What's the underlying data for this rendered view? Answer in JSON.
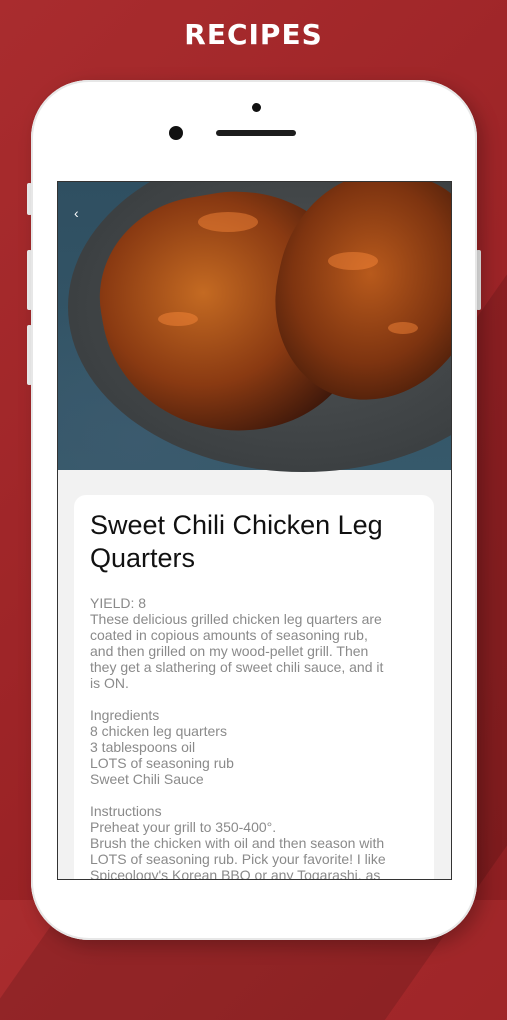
{
  "banner": {
    "title": "RECIPES"
  },
  "nav": {
    "back_icon": "chevron-left-icon",
    "back_glyph": "‹"
  },
  "recipe": {
    "title": "Sweet Chili Chicken Leg Quarters",
    "yield": "YIELD: 8",
    "description": [
      "These delicious grilled chicken leg quarters are",
      "coated in copious amounts of seasoning rub,",
      "and then grilled on my wood-pellet grill. Then",
      "they get a slathering of sweet chili sauce, and it",
      "is ON."
    ],
    "ingredients_heading": "Ingredients",
    "ingredients": [
      "8 chicken leg quarters",
      "3 tablespoons oil",
      "LOTS of seasoning rub",
      "Sweet Chili Sauce"
    ],
    "instructions_heading": "Instructions",
    "instructions": [
      "Preheat your grill to 350-400°.",
      "Brush the chicken with oil and then season with",
      "LOTS of seasoning rub. Pick your favorite! I like",
      "Spiceology's Korean BBQ or any Togarashi, as"
    ]
  },
  "colors": {
    "background": "#a92c2e",
    "card": "#ffffff",
    "text": "#111111",
    "muted": "#8a8a8a"
  }
}
